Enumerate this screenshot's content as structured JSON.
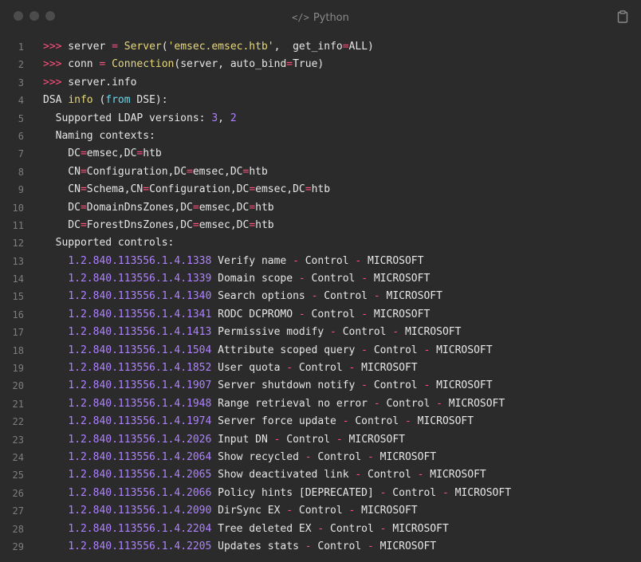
{
  "header": {
    "language": "Python",
    "code_icon": "code-icon",
    "copy_icon": "copy-icon"
  },
  "code": {
    "lines": [
      {
        "n": "1",
        "tokens": [
          {
            "t": ">>>",
            "c": "prompt"
          },
          {
            "t": " server ",
            "c": "plain"
          },
          {
            "t": "=",
            "c": "op"
          },
          {
            "t": " ",
            "c": "plain"
          },
          {
            "t": "Server",
            "c": "call"
          },
          {
            "t": "(",
            "c": "plain"
          },
          {
            "t": "'emsec.emsec.htb'",
            "c": "str"
          },
          {
            "t": ",  get_info",
            "c": "plain"
          },
          {
            "t": "=",
            "c": "op"
          },
          {
            "t": "ALL)",
            "c": "plain"
          }
        ]
      },
      {
        "n": "2",
        "tokens": [
          {
            "t": ">>>",
            "c": "prompt"
          },
          {
            "t": " conn ",
            "c": "plain"
          },
          {
            "t": "=",
            "c": "op"
          },
          {
            "t": " ",
            "c": "plain"
          },
          {
            "t": "Connection",
            "c": "call"
          },
          {
            "t": "(server, auto_bind",
            "c": "plain"
          },
          {
            "t": "=",
            "c": "op"
          },
          {
            "t": "True)",
            "c": "plain"
          }
        ]
      },
      {
        "n": "3",
        "tokens": [
          {
            "t": ">>>",
            "c": "prompt"
          },
          {
            "t": " server.info",
            "c": "plain"
          }
        ]
      },
      {
        "n": "4",
        "tokens": [
          {
            "t": "DSA ",
            "c": "plain"
          },
          {
            "t": "info",
            "c": "kw"
          },
          {
            "t": " (",
            "c": "plain"
          },
          {
            "t": "from",
            "c": "kw2"
          },
          {
            "t": " DSE):",
            "c": "plain"
          }
        ]
      },
      {
        "n": "5",
        "tokens": [
          {
            "t": "  Supported LDAP versions: ",
            "c": "plain"
          },
          {
            "t": "3",
            "c": "num"
          },
          {
            "t": ", ",
            "c": "plain"
          },
          {
            "t": "2",
            "c": "num"
          }
        ]
      },
      {
        "n": "6",
        "tokens": [
          {
            "t": "  Naming contexts:",
            "c": "plain"
          }
        ]
      },
      {
        "n": "7",
        "tokens": [
          {
            "t": "    DC",
            "c": "plain"
          },
          {
            "t": "=",
            "c": "op"
          },
          {
            "t": "emsec,DC",
            "c": "plain"
          },
          {
            "t": "=",
            "c": "op"
          },
          {
            "t": "htb",
            "c": "plain"
          }
        ]
      },
      {
        "n": "8",
        "tokens": [
          {
            "t": "    CN",
            "c": "plain"
          },
          {
            "t": "=",
            "c": "op"
          },
          {
            "t": "Configuration,DC",
            "c": "plain"
          },
          {
            "t": "=",
            "c": "op"
          },
          {
            "t": "emsec,DC",
            "c": "plain"
          },
          {
            "t": "=",
            "c": "op"
          },
          {
            "t": "htb",
            "c": "plain"
          }
        ]
      },
      {
        "n": "9",
        "tokens": [
          {
            "t": "    CN",
            "c": "plain"
          },
          {
            "t": "=",
            "c": "op"
          },
          {
            "t": "Schema,CN",
            "c": "plain"
          },
          {
            "t": "=",
            "c": "op"
          },
          {
            "t": "Configuration,DC",
            "c": "plain"
          },
          {
            "t": "=",
            "c": "op"
          },
          {
            "t": "emsec,DC",
            "c": "plain"
          },
          {
            "t": "=",
            "c": "op"
          },
          {
            "t": "htb",
            "c": "plain"
          }
        ]
      },
      {
        "n": "10",
        "tokens": [
          {
            "t": "    DC",
            "c": "plain"
          },
          {
            "t": "=",
            "c": "op"
          },
          {
            "t": "DomainDnsZones,DC",
            "c": "plain"
          },
          {
            "t": "=",
            "c": "op"
          },
          {
            "t": "emsec,DC",
            "c": "plain"
          },
          {
            "t": "=",
            "c": "op"
          },
          {
            "t": "htb",
            "c": "plain"
          }
        ]
      },
      {
        "n": "11",
        "tokens": [
          {
            "t": "    DC",
            "c": "plain"
          },
          {
            "t": "=",
            "c": "op"
          },
          {
            "t": "ForestDnsZones,DC",
            "c": "plain"
          },
          {
            "t": "=",
            "c": "op"
          },
          {
            "t": "emsec,DC",
            "c": "plain"
          },
          {
            "t": "=",
            "c": "op"
          },
          {
            "t": "htb",
            "c": "plain"
          }
        ]
      },
      {
        "n": "12",
        "tokens": [
          {
            "t": "  Supported controls:",
            "c": "plain"
          }
        ]
      },
      {
        "n": "13",
        "tokens": [
          {
            "t": "    ",
            "c": "plain"
          },
          {
            "t": "1.2.840.113556.1.4.1338",
            "c": "num"
          },
          {
            "t": " Verify name ",
            "c": "plain"
          },
          {
            "t": "-",
            "c": "op"
          },
          {
            "t": " Control ",
            "c": "plain"
          },
          {
            "t": "-",
            "c": "op"
          },
          {
            "t": " MICROSOFT",
            "c": "plain"
          }
        ]
      },
      {
        "n": "14",
        "tokens": [
          {
            "t": "    ",
            "c": "plain"
          },
          {
            "t": "1.2.840.113556.1.4.1339",
            "c": "num"
          },
          {
            "t": " Domain scope ",
            "c": "plain"
          },
          {
            "t": "-",
            "c": "op"
          },
          {
            "t": " Control ",
            "c": "plain"
          },
          {
            "t": "-",
            "c": "op"
          },
          {
            "t": " MICROSOFT",
            "c": "plain"
          }
        ]
      },
      {
        "n": "15",
        "tokens": [
          {
            "t": "    ",
            "c": "plain"
          },
          {
            "t": "1.2.840.113556.1.4.1340",
            "c": "num"
          },
          {
            "t": " Search options ",
            "c": "plain"
          },
          {
            "t": "-",
            "c": "op"
          },
          {
            "t": " Control ",
            "c": "plain"
          },
          {
            "t": "-",
            "c": "op"
          },
          {
            "t": " MICROSOFT",
            "c": "plain"
          }
        ]
      },
      {
        "n": "16",
        "tokens": [
          {
            "t": "    ",
            "c": "plain"
          },
          {
            "t": "1.2.840.113556.1.4.1341",
            "c": "num"
          },
          {
            "t": " RODC DCPROMO ",
            "c": "plain"
          },
          {
            "t": "-",
            "c": "op"
          },
          {
            "t": " Control ",
            "c": "plain"
          },
          {
            "t": "-",
            "c": "op"
          },
          {
            "t": " MICROSOFT",
            "c": "plain"
          }
        ]
      },
      {
        "n": "17",
        "tokens": [
          {
            "t": "    ",
            "c": "plain"
          },
          {
            "t": "1.2.840.113556.1.4.1413",
            "c": "num"
          },
          {
            "t": " Permissive modify ",
            "c": "plain"
          },
          {
            "t": "-",
            "c": "op"
          },
          {
            "t": " Control ",
            "c": "plain"
          },
          {
            "t": "-",
            "c": "op"
          },
          {
            "t": " MICROSOFT",
            "c": "plain"
          }
        ]
      },
      {
        "n": "18",
        "tokens": [
          {
            "t": "    ",
            "c": "plain"
          },
          {
            "t": "1.2.840.113556.1.4.1504",
            "c": "num"
          },
          {
            "t": " Attribute scoped query ",
            "c": "plain"
          },
          {
            "t": "-",
            "c": "op"
          },
          {
            "t": " Control ",
            "c": "plain"
          },
          {
            "t": "-",
            "c": "op"
          },
          {
            "t": " MICROSOFT",
            "c": "plain"
          }
        ]
      },
      {
        "n": "19",
        "tokens": [
          {
            "t": "    ",
            "c": "plain"
          },
          {
            "t": "1.2.840.113556.1.4.1852",
            "c": "num"
          },
          {
            "t": " User quota ",
            "c": "plain"
          },
          {
            "t": "-",
            "c": "op"
          },
          {
            "t": " Control ",
            "c": "plain"
          },
          {
            "t": "-",
            "c": "op"
          },
          {
            "t": " MICROSOFT",
            "c": "plain"
          }
        ]
      },
      {
        "n": "20",
        "tokens": [
          {
            "t": "    ",
            "c": "plain"
          },
          {
            "t": "1.2.840.113556.1.4.1907",
            "c": "num"
          },
          {
            "t": " Server shutdown notify ",
            "c": "plain"
          },
          {
            "t": "-",
            "c": "op"
          },
          {
            "t": " Control ",
            "c": "plain"
          },
          {
            "t": "-",
            "c": "op"
          },
          {
            "t": " MICROSOFT",
            "c": "plain"
          }
        ]
      },
      {
        "n": "21",
        "tokens": [
          {
            "t": "    ",
            "c": "plain"
          },
          {
            "t": "1.2.840.113556.1.4.1948",
            "c": "num"
          },
          {
            "t": " Range retrieval no error ",
            "c": "plain"
          },
          {
            "t": "-",
            "c": "op"
          },
          {
            "t": " Control ",
            "c": "plain"
          },
          {
            "t": "-",
            "c": "op"
          },
          {
            "t": " MICROSOFT",
            "c": "plain"
          }
        ]
      },
      {
        "n": "22",
        "tokens": [
          {
            "t": "    ",
            "c": "plain"
          },
          {
            "t": "1.2.840.113556.1.4.1974",
            "c": "num"
          },
          {
            "t": " Server force update ",
            "c": "plain"
          },
          {
            "t": "-",
            "c": "op"
          },
          {
            "t": " Control ",
            "c": "plain"
          },
          {
            "t": "-",
            "c": "op"
          },
          {
            "t": " MICROSOFT",
            "c": "plain"
          }
        ]
      },
      {
        "n": "23",
        "tokens": [
          {
            "t": "    ",
            "c": "plain"
          },
          {
            "t": "1.2.840.113556.1.4.2026",
            "c": "num"
          },
          {
            "t": " Input DN ",
            "c": "plain"
          },
          {
            "t": "-",
            "c": "op"
          },
          {
            "t": " Control ",
            "c": "plain"
          },
          {
            "t": "-",
            "c": "op"
          },
          {
            "t": " MICROSOFT",
            "c": "plain"
          }
        ]
      },
      {
        "n": "24",
        "tokens": [
          {
            "t": "    ",
            "c": "plain"
          },
          {
            "t": "1.2.840.113556.1.4.2064",
            "c": "num"
          },
          {
            "t": " Show recycled ",
            "c": "plain"
          },
          {
            "t": "-",
            "c": "op"
          },
          {
            "t": " Control ",
            "c": "plain"
          },
          {
            "t": "-",
            "c": "op"
          },
          {
            "t": " MICROSOFT",
            "c": "plain"
          }
        ]
      },
      {
        "n": "25",
        "tokens": [
          {
            "t": "    ",
            "c": "plain"
          },
          {
            "t": "1.2.840.113556.1.4.2065",
            "c": "num"
          },
          {
            "t": " Show deactivated link ",
            "c": "plain"
          },
          {
            "t": "-",
            "c": "op"
          },
          {
            "t": " Control ",
            "c": "plain"
          },
          {
            "t": "-",
            "c": "op"
          },
          {
            "t": " MICROSOFT",
            "c": "plain"
          }
        ]
      },
      {
        "n": "26",
        "tokens": [
          {
            "t": "    ",
            "c": "plain"
          },
          {
            "t": "1.2.840.113556.1.4.2066",
            "c": "num"
          },
          {
            "t": " Policy hints [DEPRECATED] ",
            "c": "plain"
          },
          {
            "t": "-",
            "c": "op"
          },
          {
            "t": " Control ",
            "c": "plain"
          },
          {
            "t": "-",
            "c": "op"
          },
          {
            "t": " MICROSOFT",
            "c": "plain"
          }
        ]
      },
      {
        "n": "27",
        "tokens": [
          {
            "t": "    ",
            "c": "plain"
          },
          {
            "t": "1.2.840.113556.1.4.2090",
            "c": "num"
          },
          {
            "t": " DirSync EX ",
            "c": "plain"
          },
          {
            "t": "-",
            "c": "op"
          },
          {
            "t": " Control ",
            "c": "plain"
          },
          {
            "t": "-",
            "c": "op"
          },
          {
            "t": " MICROSOFT",
            "c": "plain"
          }
        ]
      },
      {
        "n": "28",
        "tokens": [
          {
            "t": "    ",
            "c": "plain"
          },
          {
            "t": "1.2.840.113556.1.4.2204",
            "c": "num"
          },
          {
            "t": " Tree deleted EX ",
            "c": "plain"
          },
          {
            "t": "-",
            "c": "op"
          },
          {
            "t": " Control ",
            "c": "plain"
          },
          {
            "t": "-",
            "c": "op"
          },
          {
            "t": " MICROSOFT",
            "c": "plain"
          }
        ]
      },
      {
        "n": "29",
        "tokens": [
          {
            "t": "    ",
            "c": "plain"
          },
          {
            "t": "1.2.840.113556.1.4.2205",
            "c": "num"
          },
          {
            "t": " Updates stats ",
            "c": "plain"
          },
          {
            "t": "-",
            "c": "op"
          },
          {
            "t": " Control ",
            "c": "plain"
          },
          {
            "t": "-",
            "c": "op"
          },
          {
            "t": " MICROSOFT",
            "c": "plain"
          }
        ]
      }
    ]
  },
  "colors": {
    "background": "#2b2b2b",
    "prompt": "#ff4f7d",
    "operator": "#ff4f7d",
    "string": "#e6d87a",
    "number": "#ae81ff",
    "keyword": "#66d9ef",
    "text": "#e6e6e6",
    "line_number": "#7d7d7d"
  }
}
